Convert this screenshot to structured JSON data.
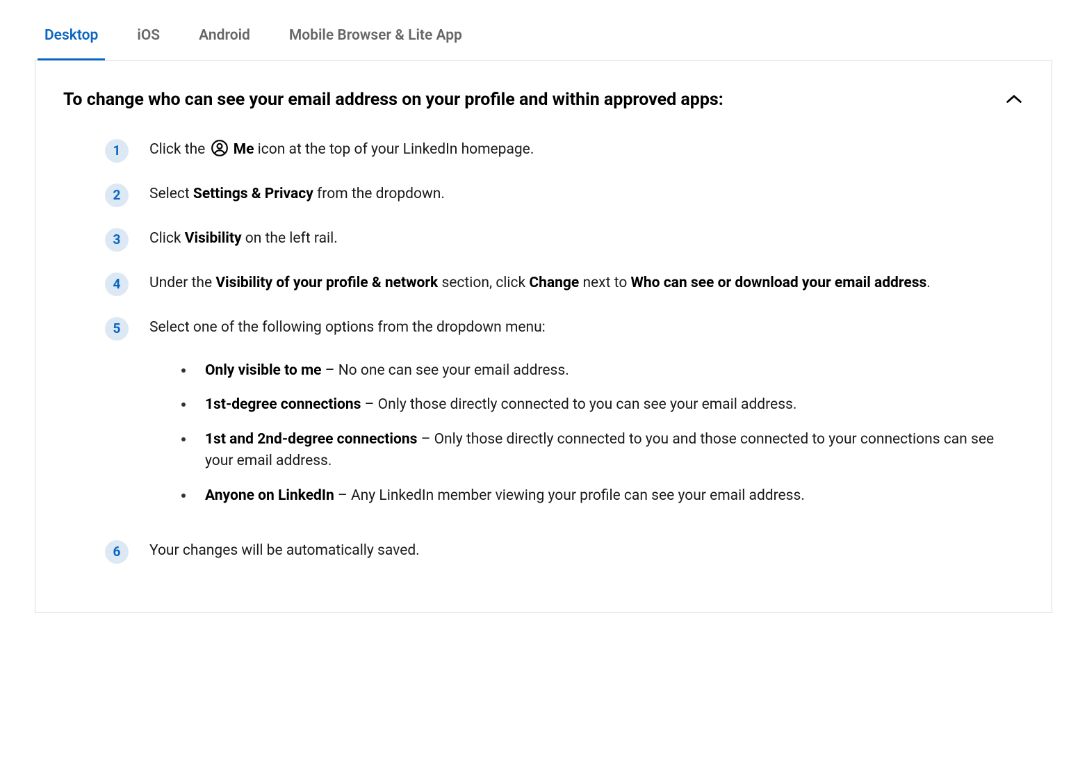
{
  "tabs": {
    "desktop": "Desktop",
    "ios": "iOS",
    "android": "Android",
    "mobile": "Mobile Browser & Lite App"
  },
  "heading": "To change who can see your email address on your profile and within approved apps:",
  "steps": {
    "s1": {
      "n": "1",
      "pre": "Click the ",
      "bold": "Me",
      "post": " icon at the top of your LinkedIn homepage."
    },
    "s2": {
      "n": "2",
      "pre": "Select ",
      "bold": "Settings & Privacy",
      "post": " from the dropdown."
    },
    "s3": {
      "n": "3",
      "pre": "Click ",
      "bold": "Visibility",
      "post": " on the left rail."
    },
    "s4": {
      "n": "4",
      "a": "Under the ",
      "b": "Visibility of your profile & network",
      "c": " section, click ",
      "d": "Change",
      "e": " next to ",
      "f": "Who can see or download your email address",
      "g": "."
    },
    "s5": {
      "n": "5",
      "text": "Select one of the following options from the dropdown menu:"
    },
    "s6": {
      "n": "6",
      "text": "Your changes will be automatically saved."
    }
  },
  "options": {
    "o1": {
      "bold": "Only visible to me",
      "rest": " – No one can see your email address."
    },
    "o2": {
      "bold": "1st-degree connections",
      "rest": " – Only those directly connected to you can see your email address."
    },
    "o3": {
      "bold": "1st and 2nd-degree connections",
      "rest": " – Only those directly connected to you and those connected to your connections can see your email address."
    },
    "o4": {
      "bold": "Anyone on LinkedIn",
      "rest": " – Any LinkedIn member viewing your profile can see your email address."
    }
  }
}
